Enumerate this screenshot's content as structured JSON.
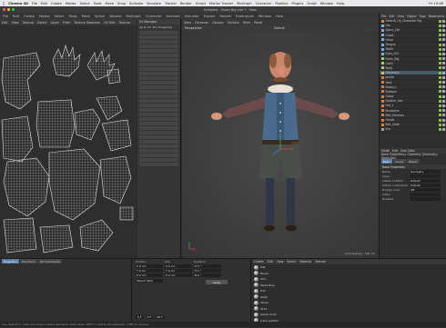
{
  "mac_menu": {
    "app": "Cinema 4D",
    "items": [
      "File",
      "Edit",
      "Create",
      "Modes",
      "Select",
      "Tools",
      "Mesh",
      "Snap",
      "Animate",
      "Simulate",
      "Tracker",
      "Render",
      "Sculpt",
      "Motion Tracker",
      "MoGraph",
      "Character",
      "Pipeline",
      "Plugins",
      "Script",
      "Window",
      "Help"
    ],
    "clock": "Fri 19:48"
  },
  "window": {
    "title": "Artifakta - Taxes Big.c4d * - Main"
  },
  "app_menu": {
    "items": [
      "File",
      "Edit",
      "Create",
      "Modes",
      "Select",
      "Tools",
      "Mesh",
      "Spline",
      "Volume",
      "MoGraph",
      "Character",
      "Animate",
      "Simulate",
      "Tracker",
      "Render",
      "Extensions",
      "Window",
      "Help"
    ],
    "layout_label": "Startup"
  },
  "uv_editor": {
    "menu": [
      "Edit",
      "View",
      "Texture",
      "Select",
      "Layer",
      "Filter",
      "Texture Sketches",
      "UV Edit",
      "Texture"
    ],
    "panel_header": "UV Manager",
    "panel_subheader": "Up to UV Tool Properties"
  },
  "viewport": {
    "menu": [
      "View",
      "Cameras",
      "Display",
      "Options",
      "Filter",
      "Panel"
    ],
    "name": "Perspective",
    "camera": "Default",
    "grid_spacing": "Grid Spacing : 100 cm"
  },
  "object_manager": {
    "menu": [
      "File",
      "Edit",
      "View",
      "Object",
      "Tags",
      "Bookmarks"
    ],
    "rows": [
      {
        "label": "Default_Ok_Character Rig",
        "selected": false,
        "color": "#d88a3a"
      },
      {
        "label": "Hip",
        "selected": false,
        "color": "#7fb0e0"
      },
      {
        "label": "Spine_Ctrl",
        "selected": false,
        "color": "#7fb0e0"
      },
      {
        "label": "Chest",
        "selected": false,
        "color": "#7fb0e0"
      },
      {
        "label": "Head",
        "selected": false,
        "color": "#7fb0e0"
      },
      {
        "label": "Tongue",
        "selected": false,
        "color": "#7fb0e0"
      },
      {
        "label": "Teeth",
        "selected": false,
        "color": "#7fb0e0"
      },
      {
        "label": "Eyes_Ctrl",
        "selected": false,
        "color": "#7fb0e0"
      },
      {
        "label": "Pants_Big",
        "selected": false,
        "color": "#a0d070"
      },
      {
        "label": "Cloth",
        "selected": false,
        "color": "#a0d070"
      },
      {
        "label": "Body",
        "selected": false,
        "color": "#a0d070"
      },
      {
        "label": "Geometry",
        "selected": true,
        "color": "#d8c050"
      },
      {
        "label": "Jacket",
        "selected": false,
        "color": "#e08040"
      },
      {
        "label": "Vest",
        "selected": false,
        "color": "#e08040"
      },
      {
        "label": "Shoes_L",
        "selected": false,
        "color": "#e08040"
      },
      {
        "label": "Buttons",
        "selected": false,
        "color": "#e08040"
      },
      {
        "label": "Collar",
        "selected": false,
        "color": "#e08040"
      },
      {
        "label": "Feather_Hat",
        "selected": false,
        "color": "#e08040"
      },
      {
        "label": "Hat_2",
        "selected": false,
        "color": "#e08040"
      },
      {
        "label": "Mustache",
        "selected": false,
        "color": "#e08040"
      },
      {
        "label": "Belt_Pouches",
        "selected": false,
        "color": "#e08040"
      },
      {
        "label": "Hands",
        "selected": false,
        "color": "#e08040"
      },
      {
        "label": "Belt_Cloth",
        "selected": false,
        "color": "#e08040"
      },
      {
        "label": "Env",
        "selected": false,
        "color": "#a0a0a0"
      }
    ]
  },
  "attribute_manager": {
    "menu": [
      "Mode",
      "Edit",
      "User Data"
    ],
    "mode_line": "Basic Properties ▸ Geometry [Geometry: Taxes Big]",
    "tabs": [
      "Basic",
      "Coord.",
      "Object"
    ],
    "active_tab": "Basic",
    "section": "Basic Properties",
    "rows": [
      {
        "label": "Name",
        "value": "Geometry"
      },
      {
        "label": "Layer",
        "value": ""
      },
      {
        "label": "Visible in Editor",
        "value": "Default"
      },
      {
        "label": "Visible in Renderer",
        "value": "Default"
      },
      {
        "label": "Display Color",
        "value": "Off"
      },
      {
        "label": "X-Ray",
        "value": ""
      },
      {
        "label": "Enabled",
        "value": ""
      }
    ]
  },
  "timeline": {
    "tabs": [
      "Projection",
      "Transform",
      "UV Commands"
    ],
    "active_tab": "Projection"
  },
  "coordinates": {
    "headers": [
      "Position",
      "Size",
      "Rotation"
    ],
    "rows": [
      {
        "pos": "X  0 cm",
        "size": "X  0 cm",
        "rot": "H  0 °"
      },
      {
        "pos": "Y  0 cm",
        "size": "Y  0 cm",
        "rot": "P  0 °"
      },
      {
        "pos": "Z  0 cm",
        "size": "Z  0 cm",
        "rot": "B  0 °"
      }
    ],
    "mode": "Object (Rel)",
    "apply": "Apply"
  },
  "playback": {
    "start": "0 F",
    "current": "0 F",
    "end": "90 F"
  },
  "material_manager": {
    "menu": [
      "Create",
      "Edit",
      "View",
      "Select",
      "Material",
      "Texture"
    ],
    "items": [
      "Mat",
      "Brows",
      "Skin",
      "Pants Blue",
      "Hair",
      "Teeth",
      "Shoes",
      "Shirt",
      "Jacket Cloth",
      "Cape Leather"
    ]
  },
  "status_bar": "Live Selection: Click and drag to select elements. Hold down SHIFT to add to the selection, CTRL to remove."
}
